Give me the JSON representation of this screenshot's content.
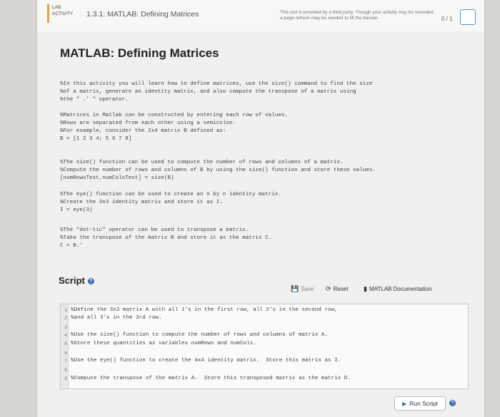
{
  "header": {
    "badge_line1": "LAB",
    "badge_line2": "ACTIVITY",
    "activity_title": "1.3.1: MATLAB: Defining Matrices",
    "provider_note": "This tool is provided by a third party. Though your activity may be recorded, a page refresh may be needed to fill the banner.",
    "score": "0 / 1"
  },
  "main": {
    "title": "MATLAB: Defining Matrices",
    "intro": [
      "%In this activity you will learn how to define matrices, use the size() command to find the size",
      "%of a matrix, generate an identity matrix, and also compute the transpose of a matrix using",
      "%the \" .' \" operator."
    ],
    "matrices": [
      "%Matrices in Matlab can be constructed by entering each row of values.",
      "%Rows are separated from each other using a semicolon.",
      "%For example, consider the 2x4 matrix B defined as:",
      "B = [1 2 3 4; 5 6 7 8]"
    ],
    "size": [
      "%The size() function can be used to compute the number of rows and columns of a matrix.",
      "%Compute the number of rows and columns of B by using the size() function and store these values.",
      "[numRowsTest,numColsTest] = size(B)"
    ],
    "eye": [
      "%The eye() function can be used to create an n by n identity matrix.",
      "%Create the 3x3 identity matrix and store it as I.",
      "I = eye(3)"
    ],
    "transpose": [
      "%The \"dot-tic\" operator can be used to transpose a matrix.",
      "%Take the transpose of the matrix B and store it as the matrix C.",
      "C = B.'"
    ]
  },
  "script": {
    "title": "Script",
    "save_label": "Save",
    "reset_label": "Reset",
    "docs_label": "MATLAB Documentation",
    "run_label": "Run Script",
    "lines": [
      {
        "n": "1",
        "text": "%Define the 3x3 matrix A with all 1's in the first row, all 2's in the second row,"
      },
      {
        "n": "2",
        "text": "%and all 3's in the 3rd row."
      },
      {
        "n": "3",
        "text": ""
      },
      {
        "n": "4",
        "text": "%Use the size() function to compute the number of rows and columns of matrix A."
      },
      {
        "n": "5",
        "text": "%Store these quantities as variables numRows and numCols."
      },
      {
        "n": "6",
        "text": ""
      },
      {
        "n": "7",
        "text": "%Use the eye() function to create the 4x4 identity matrix.  Store this matrix as I."
      },
      {
        "n": "8",
        "text": ""
      },
      {
        "n": "9",
        "text": "%Compute the transpose of the matrix A.  Store this transposed matrix as the matrix D."
      }
    ]
  }
}
